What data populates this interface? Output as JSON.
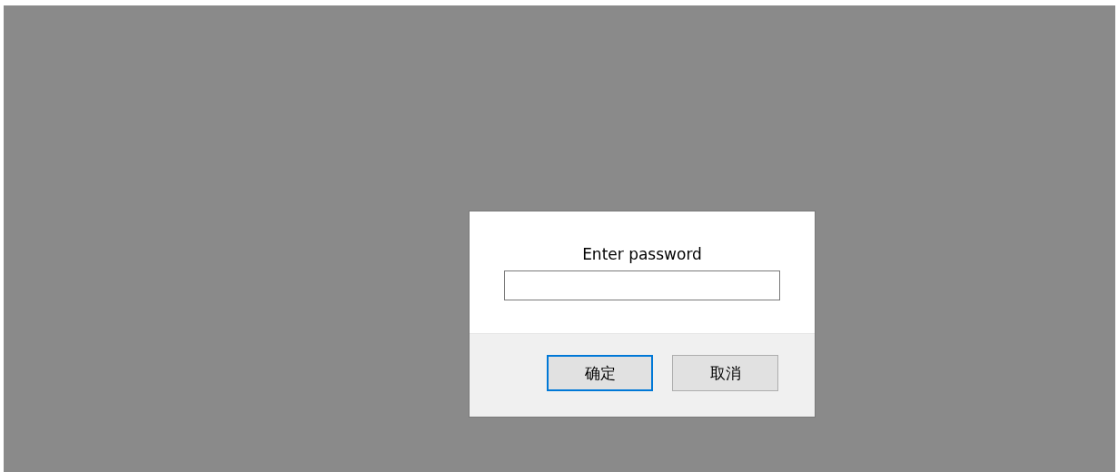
{
  "dialog": {
    "prompt": "Enter password",
    "buttons": [
      {
        "label": "确定",
        "focused": true
      },
      {
        "label": "取消",
        "focused": false
      }
    ]
  }
}
